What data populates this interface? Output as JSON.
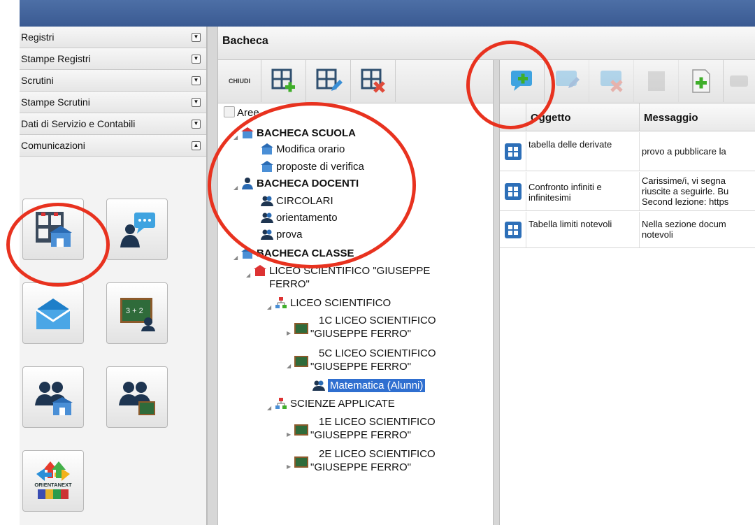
{
  "sidebar": {
    "items": [
      {
        "label": "Registri",
        "state": "collapsed"
      },
      {
        "label": "Stampe Registri",
        "state": "collapsed"
      },
      {
        "label": "Scrutini",
        "state": "collapsed"
      },
      {
        "label": "Stampe Scrutini",
        "state": "collapsed"
      },
      {
        "label": "Dati di Servizio e Contabili",
        "state": "collapsed"
      },
      {
        "label": "Comunicazioni",
        "state": "expanded"
      }
    ],
    "collapsed_glyph": "▼",
    "expanded_glyph": "▲",
    "tiles": [
      {
        "icon": "bacheca-icon"
      },
      {
        "icon": "teacher-chat-icon"
      },
      {
        "icon": "mail-icon"
      },
      {
        "icon": "blackboard-icon"
      },
      {
        "icon": "group-school-icon"
      },
      {
        "icon": "group-class-icon"
      },
      {
        "icon": "orientanext-logo",
        "logo_text": "ORIENTANEXT"
      }
    ]
  },
  "header": {
    "title": "Bacheca"
  },
  "left_toolbar": {
    "close_label": "CHIUDI"
  },
  "tree": {
    "root": "Aree",
    "nodes": [
      {
        "label": "BACHECA SCUOLA",
        "bold": true
      },
      {
        "label": "Modifica orario"
      },
      {
        "label": "proposte di verifica"
      },
      {
        "label": "BACHECA DOCENTI",
        "bold": true
      },
      {
        "label": "CIRCOLARI"
      },
      {
        "label": "orientamento"
      },
      {
        "label": "prova"
      },
      {
        "label": "BACHECA CLASSE",
        "bold": true
      },
      {
        "label": "LICEO SCIENTIFICO \"GIUSEPPE",
        "label2": "FERRO\""
      },
      {
        "label": "LICEO SCIENTIFICO"
      },
      {
        "label": "1C LICEO SCIENTIFICO",
        "label2": "\"GIUSEPPE FERRO\""
      },
      {
        "label": "5C LICEO SCIENTIFICO",
        "label2": "\"GIUSEPPE FERRO\""
      },
      {
        "label": "Matematica (Alunni)",
        "selected": true
      },
      {
        "label": "SCIENZE APPLICATE"
      },
      {
        "label": "1E LICEO SCIENTIFICO",
        "label2": "\"GIUSEPPE FERRO\""
      },
      {
        "label": "2E LICEO SCIENTIFICO",
        "label2": "\"GIUSEPPE FERRO\""
      }
    ]
  },
  "table": {
    "columns": [
      "Oggetto",
      "Messaggio"
    ],
    "rows": [
      {
        "oggetto": "tabella delle derivate",
        "messaggio": "provo a pubblicare la"
      },
      {
        "oggetto": "Confronto infiniti e infinitesimi",
        "messaggio": "Carissime/i, vi segna riuscite a seguirle. Bu Second lezione: https"
      },
      {
        "oggetto": "Tabella limiti notevoli",
        "messaggio": "Nella sezione docum notevoli"
      }
    ]
  },
  "colors": {
    "accent_blue": "#2f6fd0",
    "annotation_red": "#e8321f",
    "add_green": "#3fae2a",
    "delete_red": "#e04a3a"
  }
}
